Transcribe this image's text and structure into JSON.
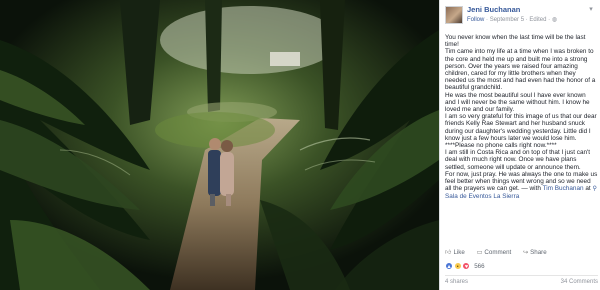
{
  "post": {
    "author": "Jeni Buchanan",
    "follow_label": "Follow",
    "date": "September 5",
    "edited": "Edited",
    "separator": "·",
    "lines": [
      "You never know when the last time will be the last time!",
      "Tim came into my life at a time when I was broken to the core and held me up and built me into a strong person. Over the years we raised four amazing children, cared for my little brothers when they needed us the most and had even had the honor of a beautiful grandchild.",
      "He was the most beautiful soul I have ever known and I will never be the same without him. I know he loved me and our family.",
      "I am so very grateful for this image of us that our dear friends Kelly Rae Stewart and her husband snuck during our daughter's wedding yesterday. Little did I know just a few hours later we would lose him.",
      "****Please no phone calls right now.****",
      "I am still in Costa Rica and on top of that I just can't deal with much right now. Once we have plans settled, someone will update or announce them.",
      "For now, just pray. He was always the one to make us feel better when things went wrong and so we need all the prayers we can get."
    ],
    "with_prefix": "— with",
    "with_person": "Tim Buchanan",
    "at_prefix": "at",
    "place": "Sala de Eventos La Sierra"
  },
  "actions": {
    "like": "Like",
    "comment": "Comment",
    "share": "Share"
  },
  "reactions": {
    "count": "566"
  },
  "footer": {
    "shares": "4 shares",
    "comments": "34 Comments"
  },
  "icons": {
    "avatar": "avatar-photo",
    "caret": "chevron-down-icon",
    "globe": "globe-icon",
    "pin": "location-pin-icon",
    "like": "thumbs-up-icon",
    "comment": "comment-icon",
    "share": "share-icon"
  },
  "colors": {
    "link": "#365899",
    "meta": "#90949c",
    "text": "#1d2129",
    "like_reaction": "#4b76d6",
    "sad_reaction": "#f7c94e",
    "love_reaction": "#f25268"
  }
}
